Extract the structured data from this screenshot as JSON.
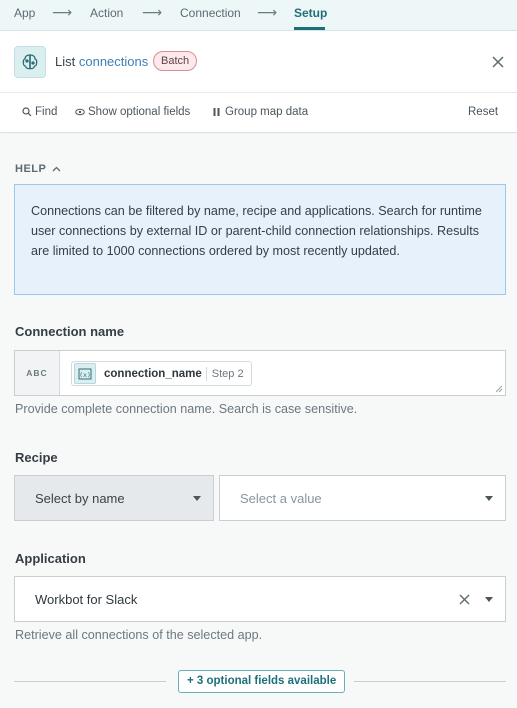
{
  "steps": [
    {
      "label": "App"
    },
    {
      "label": "Action"
    },
    {
      "label": "Connection"
    },
    {
      "label": "Setup"
    }
  ],
  "header": {
    "title_prefix": "List",
    "title_object": "connections",
    "badge": "Batch"
  },
  "toolbar": {
    "find": "Find",
    "optional_fields": "Show optional fields",
    "group_map": "Group map data",
    "reset": "Reset"
  },
  "help": {
    "label": "HELP",
    "text": "Connections can be filtered by name, recipe and applications. Search for runtime user connections by external ID or parent-child connection relationships. Results are limited to 1000 connections ordered by most recently updated."
  },
  "connection_name": {
    "label": "Connection name",
    "type_tag": "ABC",
    "pill_name": "connection_name",
    "pill_step": "Step 2",
    "hint": "Provide complete connection name. Search is case sensitive."
  },
  "recipe": {
    "label": "Recipe",
    "mode_value": "Select by name",
    "placeholder": "Select a value"
  },
  "application": {
    "label": "Application",
    "value": "Workbot for Slack",
    "hint": "Retrieve all connections of the selected app."
  },
  "optional": {
    "button": "+ 3 optional fields available"
  },
  "colors": {
    "accent": "#1f6f7a",
    "link": "#3e7fb4",
    "help_bg": "#e6f1fb",
    "help_border": "#9cc6ec",
    "badge_border": "#d98c99"
  }
}
